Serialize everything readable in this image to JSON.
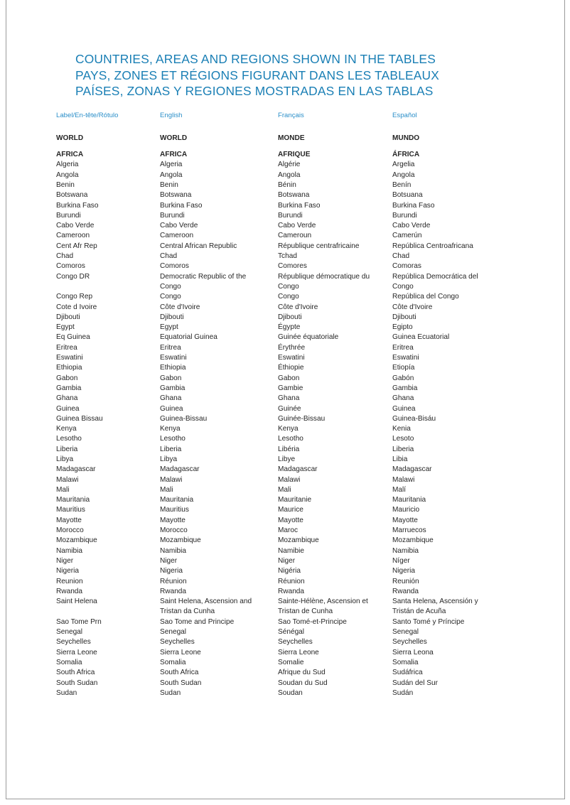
{
  "document": {
    "title_lines": [
      "COUNTRIES, AREAS AND REGIONS SHOWN IN THE TABLES",
      "PAYS, ZONES ET RÉGIONS FIGURANT DANS LES TABLEAUX",
      "PAÍSES, ZONAS Y REGIONES MOSTRADAS EN LAS TABLAS"
    ],
    "title_color": "#1a7fb5",
    "header_color": "#2b8fc9",
    "body_color": "#262626"
  },
  "table": {
    "headers": [
      "Label/En-tête/Rótulo",
      "English",
      "Français",
      "Español"
    ],
    "rows": [
      {
        "style": "bold",
        "spacer_before": false,
        "cells": [
          [
            "WORLD"
          ],
          [
            "WORLD"
          ],
          [
            "MONDE"
          ],
          [
            "MUNDO"
          ]
        ]
      },
      {
        "style": "bold",
        "spacer_before": true,
        "cells": [
          [
            "AFRICA"
          ],
          [
            "AFRICA"
          ],
          [
            "AFRIQUE"
          ],
          [
            "ÁFRICA"
          ]
        ]
      },
      {
        "style": "normal",
        "spacer_before": false,
        "cells": [
          [
            "Algeria"
          ],
          [
            "Algeria"
          ],
          [
            "Algérie"
          ],
          [
            "Argelia"
          ]
        ]
      },
      {
        "style": "normal",
        "spacer_before": false,
        "cells": [
          [
            "Angola"
          ],
          [
            "Angola"
          ],
          [
            "Angola"
          ],
          [
            "Angola"
          ]
        ]
      },
      {
        "style": "normal",
        "spacer_before": false,
        "cells": [
          [
            "Benin"
          ],
          [
            "Benin"
          ],
          [
            "Bénin"
          ],
          [
            "Benín"
          ]
        ]
      },
      {
        "style": "normal",
        "spacer_before": false,
        "cells": [
          [
            "Botswana"
          ],
          [
            "Botswana"
          ],
          [
            "Botswana"
          ],
          [
            "Botsuana"
          ]
        ]
      },
      {
        "style": "normal",
        "spacer_before": false,
        "cells": [
          [
            "Burkina Faso"
          ],
          [
            "Burkina Faso"
          ],
          [
            "Burkina Faso"
          ],
          [
            "Burkina Faso"
          ]
        ]
      },
      {
        "style": "normal",
        "spacer_before": false,
        "cells": [
          [
            "Burundi"
          ],
          [
            "Burundi"
          ],
          [
            "Burundi"
          ],
          [
            "Burundi"
          ]
        ]
      },
      {
        "style": "normal",
        "spacer_before": false,
        "cells": [
          [
            "Cabo Verde"
          ],
          [
            "Cabo Verde"
          ],
          [
            "Cabo Verde"
          ],
          [
            "Cabo Verde"
          ]
        ]
      },
      {
        "style": "normal",
        "spacer_before": false,
        "cells": [
          [
            "Cameroon"
          ],
          [
            "Cameroon"
          ],
          [
            "Cameroun"
          ],
          [
            "Camerún"
          ]
        ]
      },
      {
        "style": "normal",
        "spacer_before": false,
        "cells": [
          [
            "Cent Afr Rep"
          ],
          [
            "Central African Republic"
          ],
          [
            "République centrafricaine"
          ],
          [
            "República Centroafricana"
          ]
        ]
      },
      {
        "style": "normal",
        "spacer_before": false,
        "cells": [
          [
            "Chad"
          ],
          [
            "Chad"
          ],
          [
            "Tchad"
          ],
          [
            "Chad"
          ]
        ]
      },
      {
        "style": "normal",
        "spacer_before": false,
        "cells": [
          [
            "Comoros"
          ],
          [
            "Comoros"
          ],
          [
            "Comores"
          ],
          [
            "Comoras"
          ]
        ]
      },
      {
        "style": "normal",
        "spacer_before": false,
        "cells": [
          [
            "Congo DR"
          ],
          [
            "Democratic Republic of the",
            "Congo"
          ],
          [
            "République démocratique du",
            "Congo"
          ],
          [
            "República Democrática del",
            "Congo"
          ]
        ]
      },
      {
        "style": "normal",
        "spacer_before": false,
        "cells": [
          [
            "Congo Rep"
          ],
          [
            "Congo"
          ],
          [
            "Congo"
          ],
          [
            "República del Congo"
          ]
        ]
      },
      {
        "style": "normal",
        "spacer_before": false,
        "cells": [
          [
            "Cote d Ivoire"
          ],
          [
            "Côte d'Ivoire"
          ],
          [
            "Côte d'Ivoire"
          ],
          [
            "Côte d'Ivoire"
          ]
        ]
      },
      {
        "style": "normal",
        "spacer_before": false,
        "cells": [
          [
            "Djibouti"
          ],
          [
            "Djibouti"
          ],
          [
            "Djibouti"
          ],
          [
            "Djibouti"
          ]
        ]
      },
      {
        "style": "normal",
        "spacer_before": false,
        "cells": [
          [
            "Egypt"
          ],
          [
            "Egypt"
          ],
          [
            "Égypte"
          ],
          [
            "Egipto"
          ]
        ]
      },
      {
        "style": "normal",
        "spacer_before": false,
        "cells": [
          [
            "Eq Guinea"
          ],
          [
            "Equatorial Guinea"
          ],
          [
            "Guinée équatoriale"
          ],
          [
            "Guinea Ecuatorial"
          ]
        ]
      },
      {
        "style": "normal",
        "spacer_before": false,
        "cells": [
          [
            "Eritrea"
          ],
          [
            "Eritrea"
          ],
          [
            "Érythrée"
          ],
          [
            "Eritrea"
          ]
        ]
      },
      {
        "style": "normal",
        "spacer_before": false,
        "cells": [
          [
            "Eswatini"
          ],
          [
            "Eswatini"
          ],
          [
            "Eswatini"
          ],
          [
            "Eswatini"
          ]
        ]
      },
      {
        "style": "normal",
        "spacer_before": false,
        "cells": [
          [
            "Ethiopia"
          ],
          [
            "Ethiopia"
          ],
          [
            "Éthiopie"
          ],
          [
            "Etiopía"
          ]
        ]
      },
      {
        "style": "normal",
        "spacer_before": false,
        "cells": [
          [
            "Gabon"
          ],
          [
            "Gabon"
          ],
          [
            "Gabon"
          ],
          [
            "Gabón"
          ]
        ]
      },
      {
        "style": "normal",
        "spacer_before": false,
        "cells": [
          [
            "Gambia"
          ],
          [
            "Gambia"
          ],
          [
            "Gambie"
          ],
          [
            "Gambia"
          ]
        ]
      },
      {
        "style": "normal",
        "spacer_before": false,
        "cells": [
          [
            "Ghana"
          ],
          [
            "Ghana"
          ],
          [
            "Ghana"
          ],
          [
            "Ghana"
          ]
        ]
      },
      {
        "style": "normal",
        "spacer_before": false,
        "cells": [
          [
            "Guinea"
          ],
          [
            "Guinea"
          ],
          [
            "Guinée"
          ],
          [
            "Guinea"
          ]
        ]
      },
      {
        "style": "normal",
        "spacer_before": false,
        "cells": [
          [
            "Guinea Bissau"
          ],
          [
            "Guinea-Bissau"
          ],
          [
            "Guinée-Bissau"
          ],
          [
            "Guinea-Bisáu"
          ]
        ]
      },
      {
        "style": "normal",
        "spacer_before": false,
        "cells": [
          [
            "Kenya"
          ],
          [
            "Kenya"
          ],
          [
            "Kenya"
          ],
          [
            "Kenia"
          ]
        ]
      },
      {
        "style": "normal",
        "spacer_before": false,
        "cells": [
          [
            "Lesotho"
          ],
          [
            "Lesotho"
          ],
          [
            "Lesotho"
          ],
          [
            "Lesoto"
          ]
        ]
      },
      {
        "style": "normal",
        "spacer_before": false,
        "cells": [
          [
            "Liberia"
          ],
          [
            "Liberia"
          ],
          [
            "Libéria"
          ],
          [
            "Liberia"
          ]
        ]
      },
      {
        "style": "normal",
        "spacer_before": false,
        "cells": [
          [
            "Libya"
          ],
          [
            "Libya"
          ],
          [
            "Libye"
          ],
          [
            "Libia"
          ]
        ]
      },
      {
        "style": "normal",
        "spacer_before": false,
        "cells": [
          [
            "Madagascar"
          ],
          [
            "Madagascar"
          ],
          [
            "Madagascar"
          ],
          [
            "Madagascar"
          ]
        ]
      },
      {
        "style": "normal",
        "spacer_before": false,
        "cells": [
          [
            "Malawi"
          ],
          [
            "Malawi"
          ],
          [
            "Malawi"
          ],
          [
            "Malawi"
          ]
        ]
      },
      {
        "style": "normal",
        "spacer_before": false,
        "cells": [
          [
            "Mali"
          ],
          [
            "Mali"
          ],
          [
            "Mali"
          ],
          [
            "Malí"
          ]
        ]
      },
      {
        "style": "normal",
        "spacer_before": false,
        "cells": [
          [
            "Mauritania"
          ],
          [
            "Mauritania"
          ],
          [
            "Mauritanie"
          ],
          [
            "Mauritania"
          ]
        ]
      },
      {
        "style": "normal",
        "spacer_before": false,
        "cells": [
          [
            "Mauritius"
          ],
          [
            "Mauritius"
          ],
          [
            "Maurice"
          ],
          [
            "Mauricio"
          ]
        ]
      },
      {
        "style": "normal",
        "spacer_before": false,
        "cells": [
          [
            "Mayotte"
          ],
          [
            "Mayotte"
          ],
          [
            "Mayotte"
          ],
          [
            "Mayotte"
          ]
        ]
      },
      {
        "style": "normal",
        "spacer_before": false,
        "cells": [
          [
            "Morocco"
          ],
          [
            "Morocco"
          ],
          [
            "Maroc"
          ],
          [
            "Marruecos"
          ]
        ]
      },
      {
        "style": "normal",
        "spacer_before": false,
        "cells": [
          [
            "Mozambique"
          ],
          [
            "Mozambique"
          ],
          [
            "Mozambique"
          ],
          [
            "Mozambique"
          ]
        ]
      },
      {
        "style": "normal",
        "spacer_before": false,
        "cells": [
          [
            "Namibia"
          ],
          [
            "Namibia"
          ],
          [
            "Namibie"
          ],
          [
            "Namibia"
          ]
        ]
      },
      {
        "style": "normal",
        "spacer_before": false,
        "cells": [
          [
            "Niger"
          ],
          [
            "Niger"
          ],
          [
            "Niger"
          ],
          [
            "Níger"
          ]
        ]
      },
      {
        "style": "normal",
        "spacer_before": false,
        "cells": [
          [
            "Nigeria"
          ],
          [
            "Nigeria"
          ],
          [
            "Nigéria"
          ],
          [
            "Nigeria"
          ]
        ]
      },
      {
        "style": "normal",
        "spacer_before": false,
        "cells": [
          [
            "Reunion"
          ],
          [
            "Réunion"
          ],
          [
            "Réunion"
          ],
          [
            "Reunión"
          ]
        ]
      },
      {
        "style": "normal",
        "spacer_before": false,
        "cells": [
          [
            "Rwanda"
          ],
          [
            "Rwanda"
          ],
          [
            "Rwanda"
          ],
          [
            "Rwanda"
          ]
        ]
      },
      {
        "style": "normal",
        "spacer_before": false,
        "cells": [
          [
            "Saint Helena"
          ],
          [
            "Saint Helena, Ascension and",
            "Tristan da Cunha"
          ],
          [
            "Sainte-Hélène, Ascension et",
            "Tristan de Cunha"
          ],
          [
            "Santa Helena, Ascensión y",
            "Tristán de Acuña"
          ]
        ]
      },
      {
        "style": "normal",
        "spacer_before": false,
        "cells": [
          [
            "Sao Tome Prn"
          ],
          [
            "Sao Tome and Principe"
          ],
          [
            "Sao Tomé-et-Principe"
          ],
          [
            "Santo Tomé y Príncipe"
          ]
        ]
      },
      {
        "style": "normal",
        "spacer_before": false,
        "cells": [
          [
            "Senegal"
          ],
          [
            "Senegal"
          ],
          [
            "Sénégal"
          ],
          [
            "Senegal"
          ]
        ]
      },
      {
        "style": "normal",
        "spacer_before": false,
        "cells": [
          [
            "Seychelles"
          ],
          [
            "Seychelles"
          ],
          [
            "Seychelles"
          ],
          [
            "Seychelles"
          ]
        ]
      },
      {
        "style": "normal",
        "spacer_before": false,
        "cells": [
          [
            "Sierra Leone"
          ],
          [
            "Sierra Leone"
          ],
          [
            "Sierra Leone"
          ],
          [
            "Sierra Leona"
          ]
        ]
      },
      {
        "style": "normal",
        "spacer_before": false,
        "cells": [
          [
            "Somalia"
          ],
          [
            "Somalia"
          ],
          [
            "Somalie"
          ],
          [
            "Somalia"
          ]
        ]
      },
      {
        "style": "normal",
        "spacer_before": false,
        "cells": [
          [
            "South Africa"
          ],
          [
            "South Africa"
          ],
          [
            "Afrique du Sud"
          ],
          [
            "Sudáfrica"
          ]
        ]
      },
      {
        "style": "normal",
        "spacer_before": false,
        "cells": [
          [
            "South Sudan"
          ],
          [
            "South Sudan"
          ],
          [
            "Soudan du Sud"
          ],
          [
            "Sudán del Sur"
          ]
        ]
      },
      {
        "style": "normal",
        "spacer_before": false,
        "cells": [
          [
            "Sudan"
          ],
          [
            "Sudan"
          ],
          [
            "Soudan"
          ],
          [
            "Sudán"
          ]
        ]
      }
    ]
  }
}
